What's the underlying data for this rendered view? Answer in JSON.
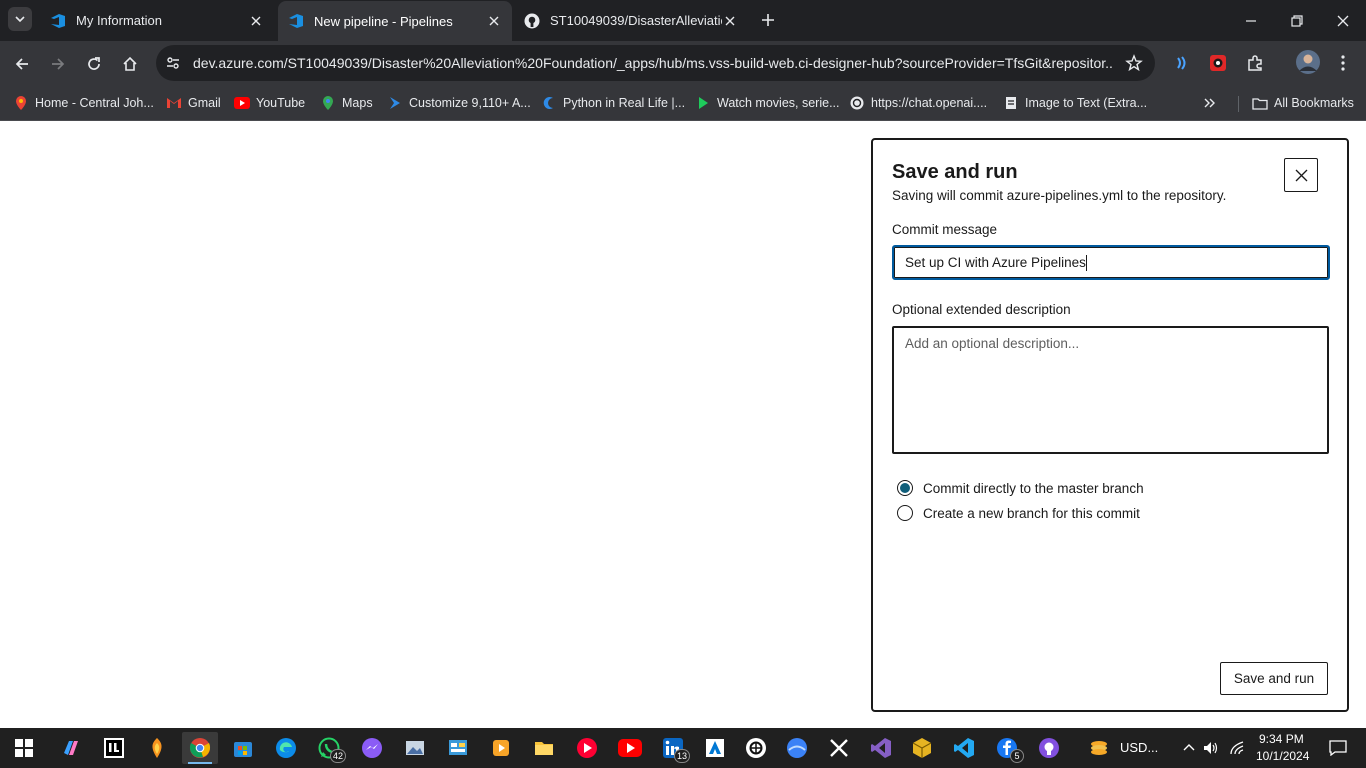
{
  "browser": {
    "tabs": [
      {
        "title": "My Information",
        "active": false
      },
      {
        "title": "New pipeline - Pipelines",
        "active": true
      },
      {
        "title": "ST10049039/DisasterAlleviation",
        "active": false
      }
    ],
    "url": "dev.azure.com/ST10049039/Disaster%20Alleviation%20Foundation/_apps/hub/ms.vss-build-web.ci-designer-hub?sourceProvider=TfsGit&repositor...",
    "bookmarks": [
      {
        "label": "Home - Central Joh..."
      },
      {
        "label": "Gmail"
      },
      {
        "label": "YouTube"
      },
      {
        "label": "Maps"
      },
      {
        "label": "Customize 9,110+ A..."
      },
      {
        "label": "Python in Real Life |..."
      },
      {
        "label": "Watch movies, serie..."
      },
      {
        "label": "https://chat.openai...."
      },
      {
        "label": "Image to Text (Extra..."
      }
    ],
    "all_bookmarks": "All Bookmarks"
  },
  "dialog": {
    "title": "Save and run",
    "subtitle": "Saving will commit azure-pipelines.yml to the repository.",
    "commit_label": "Commit message",
    "commit_value": "Set up CI with Azure Pipelines",
    "desc_label": "Optional extended description",
    "desc_placeholder": "Add an optional description...",
    "options": [
      {
        "label": "Commit directly to the master branch",
        "checked": true
      },
      {
        "label": "Create a new branch for this commit",
        "checked": false
      }
    ],
    "submit_label": "Save and run"
  },
  "taskbar": {
    "badges": {
      "whatsapp": "42",
      "linkedin": "13",
      "facebook": "5"
    },
    "currency": "USD...",
    "time": "9:34 PM",
    "date": "10/1/2024"
  },
  "colors": {
    "accent": "#0f5e7a",
    "focus": "#005a9e",
    "tab_bg": "#202124",
    "toolbar_bg": "#35363a",
    "taskbar_bg": "#202020"
  }
}
